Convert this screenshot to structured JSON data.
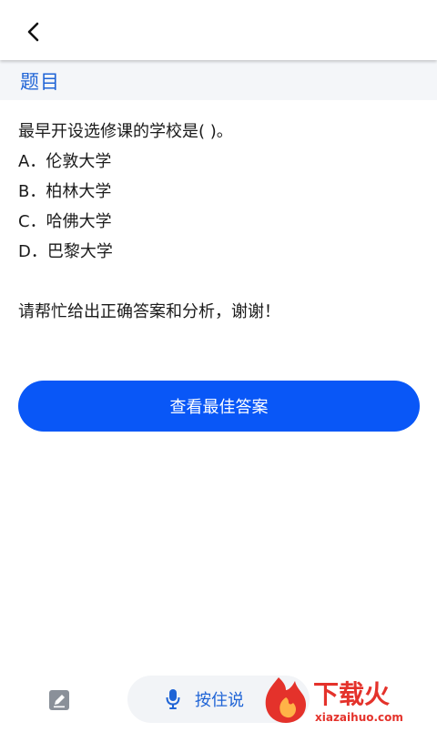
{
  "header": {
    "back_icon": "chevron-left-icon"
  },
  "section": {
    "title": "题目"
  },
  "question": {
    "text": "最早开设选修课的学校是( )。",
    "options": [
      "A．伦敦大学",
      "B．柏林大学",
      "C．哈佛大学",
      "D．巴黎大学"
    ],
    "request": "请帮忙给出正确答案和分析，谢谢！"
  },
  "actions": {
    "best_answer_label": "查看最佳答案"
  },
  "bottom": {
    "voice_label": "按住说",
    "edit_icon": "edit-icon",
    "mic_icon": "microphone-icon"
  },
  "watermark": {
    "name": "下载火",
    "url": "xiazaihuo.com"
  },
  "colors": {
    "accent": "#0957f7",
    "title_blue": "#1f64d6",
    "watermark_red": "#e4322b"
  }
}
